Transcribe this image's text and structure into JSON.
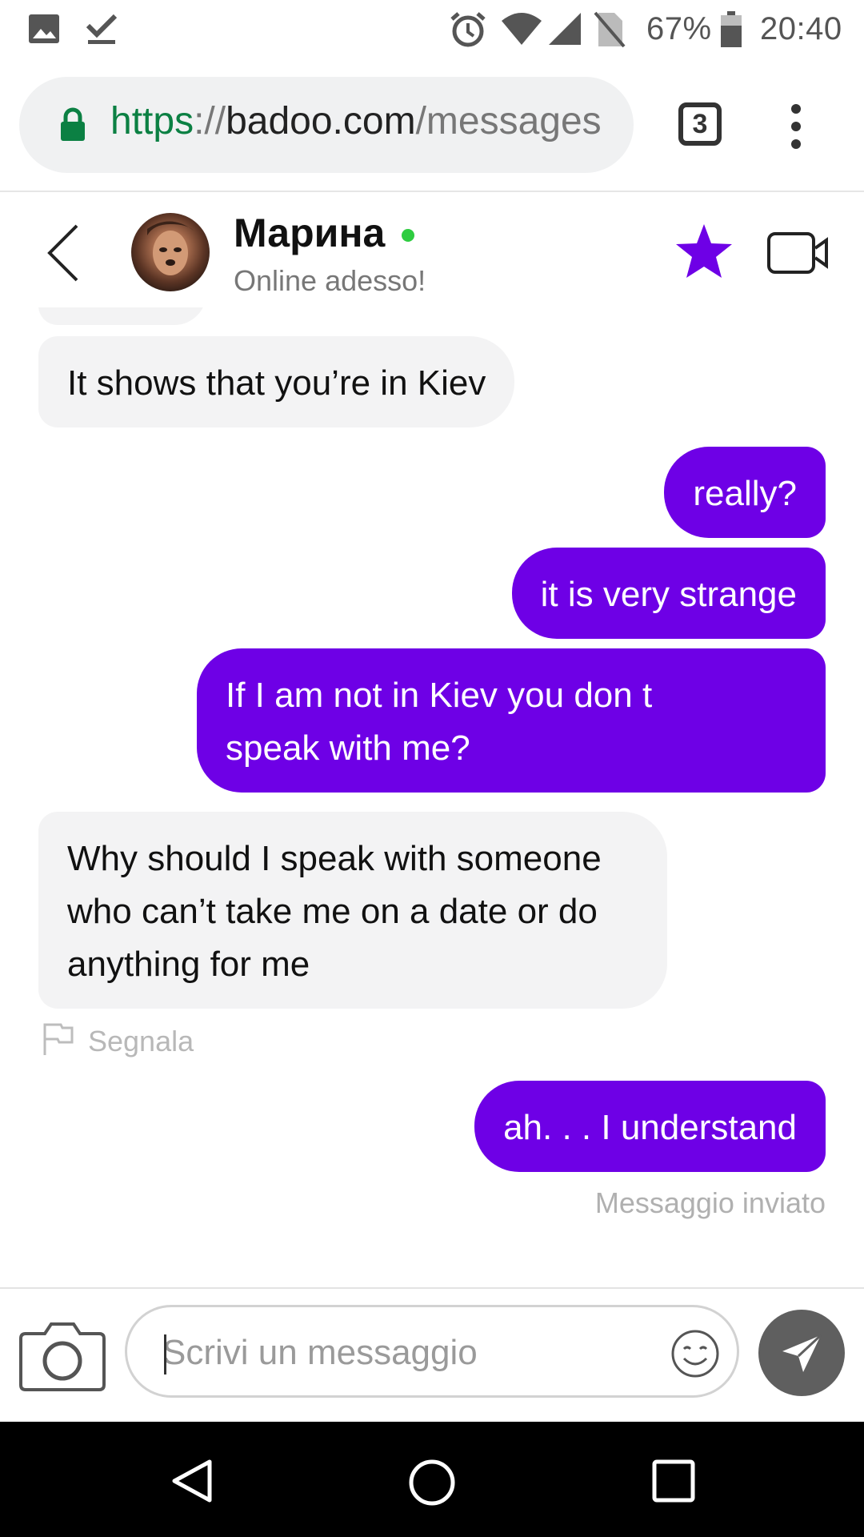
{
  "status_bar": {
    "left_icons": [
      "image-icon",
      "download-done-icon"
    ],
    "right_icons": [
      "alarm-icon",
      "wifi-icon",
      "signal-icon",
      "no-sim-icon",
      "battery-icon"
    ],
    "battery": "67%",
    "time": "20:40"
  },
  "browser": {
    "url_scheme": "https",
    "url_separator": "://",
    "url_host": "badoo.com",
    "url_path": "/messages",
    "tab_count": "3",
    "secure_color": "#0b8043"
  },
  "chat_header": {
    "name": "Марина",
    "status": "Online adesso!",
    "online_color": "#2ecc40",
    "accent_color": "#6e00e6"
  },
  "messages": [
    {
      "direction": "in",
      "text": "It shows that you’re in Kiev"
    },
    {
      "direction": "out",
      "text": "really?"
    },
    {
      "direction": "out",
      "text": "it is very strange"
    },
    {
      "direction": "out",
      "text": "If I am not in Kiev you don t speak with me?"
    },
    {
      "direction": "in",
      "text": "Why should I speak with someone who can’t take me on a date or do anything for me"
    },
    {
      "direction": "out",
      "text": "ah. . . I understand"
    }
  ],
  "report_label": "Segnala",
  "delivery_status": "Messaggio inviato",
  "composer": {
    "placeholder": "Scrivi un messaggio",
    "value": ""
  },
  "colors": {
    "outgoing_bubble": "#6e00e6",
    "incoming_bubble": "#f3f3f4",
    "send_button": "#5f5f5f"
  }
}
